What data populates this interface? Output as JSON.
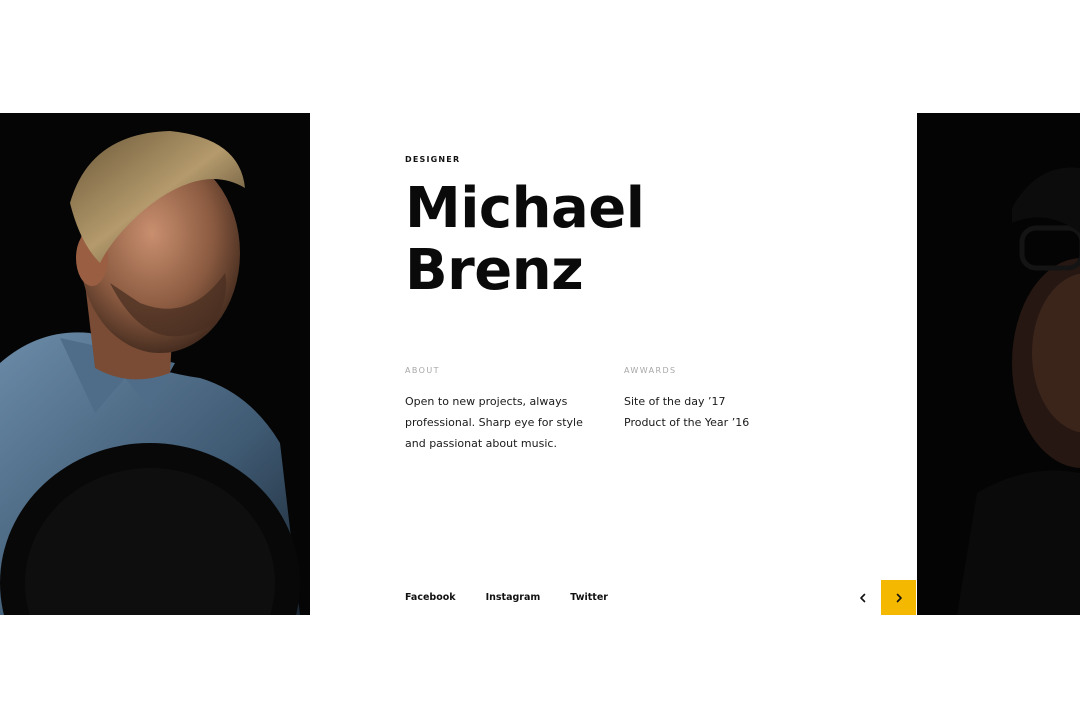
{
  "profile": {
    "role": "DESIGNER",
    "first_name": "Michael",
    "last_name": "Brenz"
  },
  "about": {
    "label": "ABOUT",
    "text": "Open to new projects, always professional. Sharp eye for style and passionat about music."
  },
  "awards": {
    "label": "AWWARDS",
    "items": [
      "Site of the day ’17",
      "Product of the Year ’16"
    ]
  },
  "social": {
    "facebook": "Facebook",
    "instagram": "Instagram",
    "twitter": "Twitter"
  },
  "navigation": {
    "prev_icon": "chevron-left-icon",
    "next_icon": "chevron-right-icon",
    "accent_color": "#f5b800"
  }
}
